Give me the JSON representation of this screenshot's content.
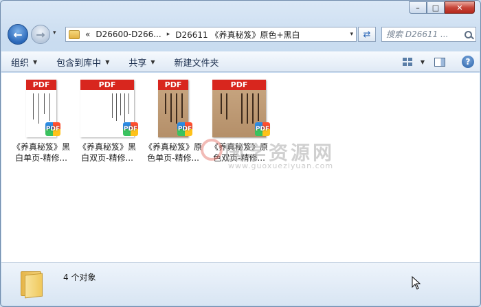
{
  "window": {
    "minimize_glyph": "–",
    "maximize_glyph": "□",
    "close_glyph": "✕"
  },
  "nav": {
    "back_glyph": "←",
    "forward_glyph": "→",
    "dropdown_glyph": "▾"
  },
  "address": {
    "overflow": "«",
    "crumbs": [
      "D26600-D266...",
      "D26611 《养真秘笈》原色+黑白"
    ],
    "separator": "▸",
    "dropdown_glyph": "▾",
    "refresh_glyph": "⇄"
  },
  "search": {
    "placeholder": "搜索 D26611 ..."
  },
  "toolbar": {
    "organize": "组织",
    "include_in_library": "包含到库中",
    "share": "共享",
    "new_folder": "新建文件夹",
    "arrow": "▼",
    "help": "?"
  },
  "files": [
    {
      "name": "《养真秘笈》黑白单页-精修...",
      "pdf_label": "PDF",
      "badge": "PDF"
    },
    {
      "name": "《养真秘笈》黑白双页-精修...",
      "pdf_label": "PDF",
      "badge": "PDF"
    },
    {
      "name": "《养真秘笈》原色单页-精修...",
      "pdf_label": "PDF",
      "badge": "PDF"
    },
    {
      "name": "《养真秘笈》原色双页-精修...",
      "pdf_label": "PDF",
      "badge": "PDF"
    }
  ],
  "watermark": {
    "text": "国学资源网",
    "url": "www.guoxueziyuan.com"
  },
  "status": {
    "count_text": "4 个对象"
  },
  "colors": {
    "pdf_red": "#d8261e",
    "accent_blue": "#2a67b8",
    "window_frame": "#bcd3ec"
  }
}
